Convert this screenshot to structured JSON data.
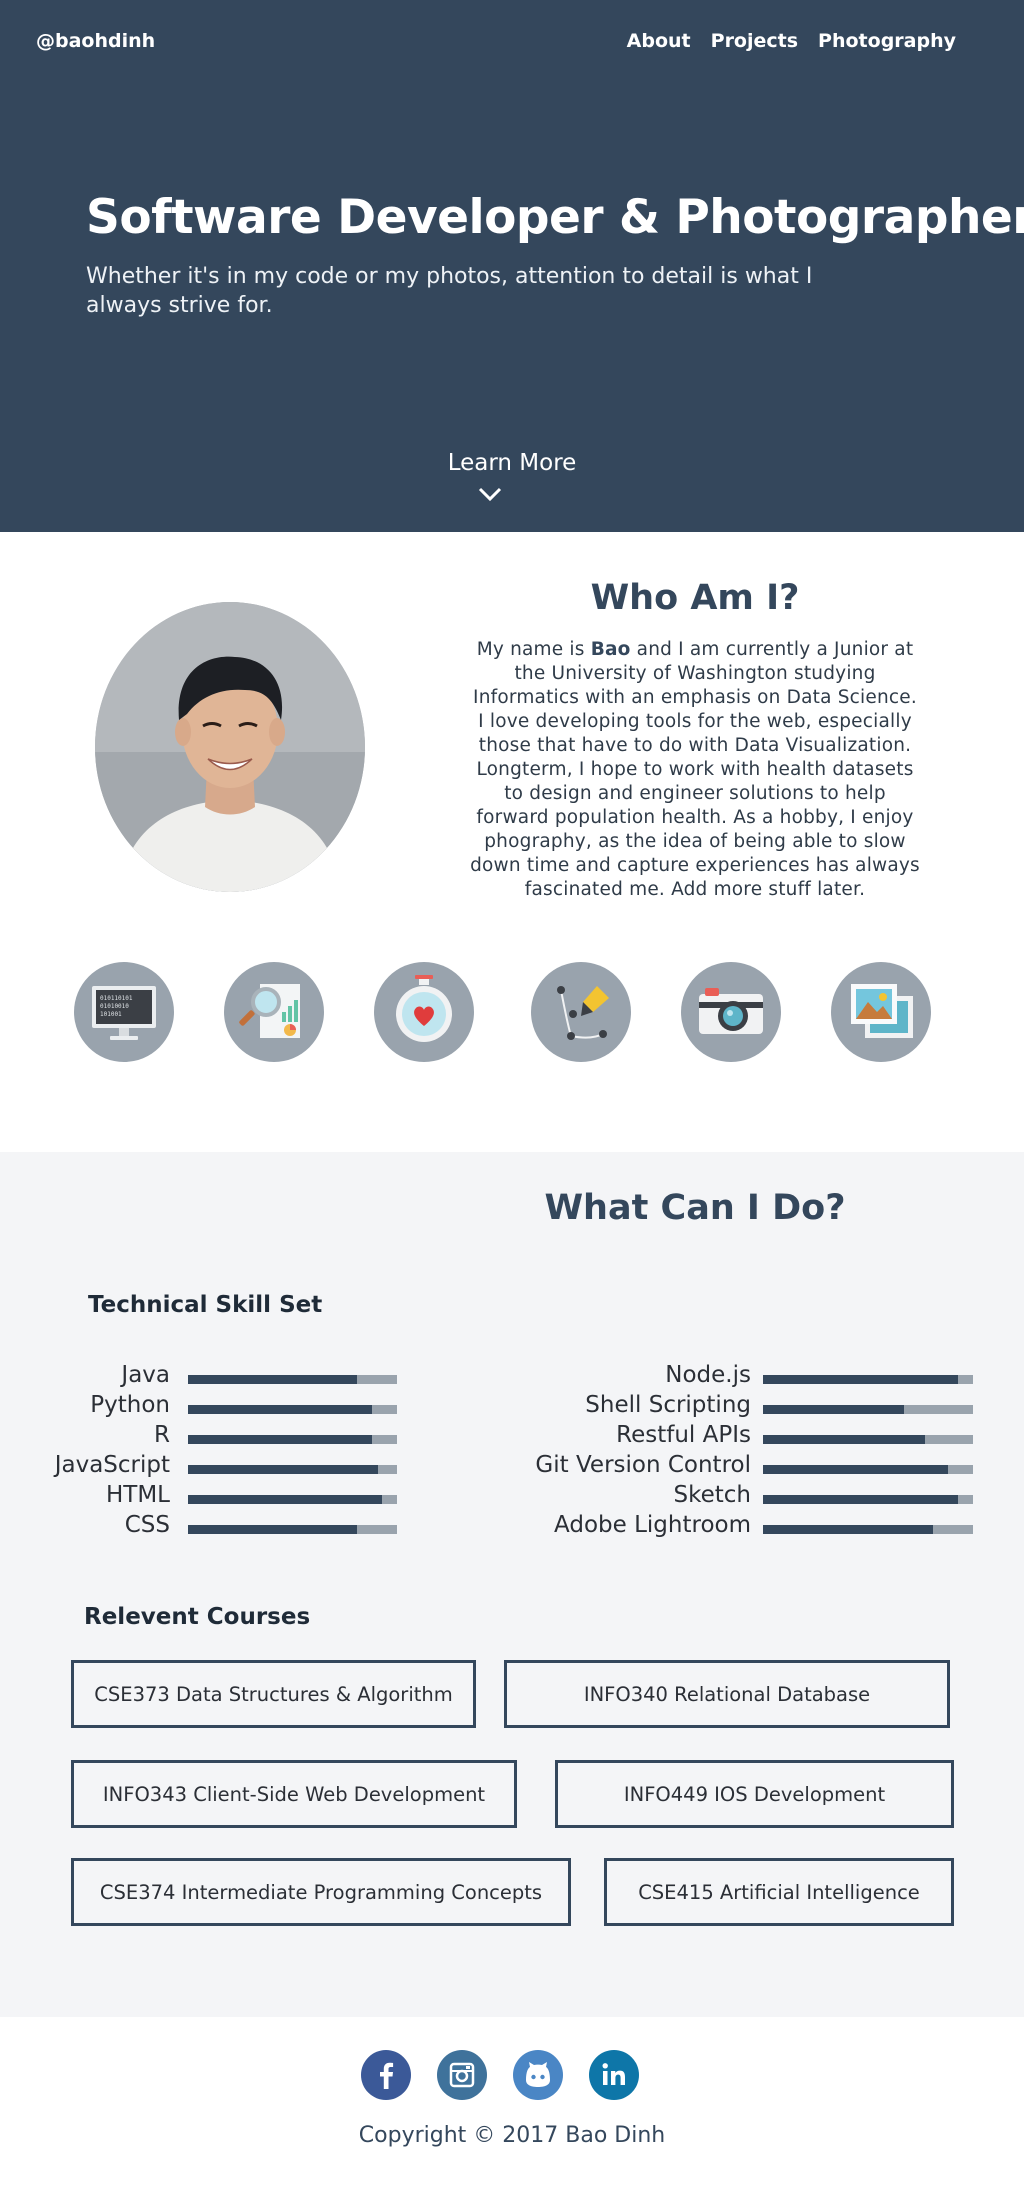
{
  "header": {
    "brand": "@baohdinh",
    "nav": [
      "About",
      "Projects",
      "Photography"
    ]
  },
  "hero": {
    "title": "Software Developer & Photographer",
    "subtitle": "Whether it's in my code or my photos, attention to detail is what I always strive for.",
    "learn_more": "Learn More"
  },
  "about": {
    "title": "Who Am I?",
    "text_before": "My name is ",
    "name": "Bao",
    "text_after": " and I am currently a Junior at the University of Washington studying Informatics with an emphasis on Data Science. I love developing tools for the web, especially those that have to do with Data Visualization. Longterm, I hope to work with health datasets to design and engineer solutions to help forward population health. As a hobby, I enjoy phography, as the idea of being able to slow down time and capture experiences has always fascinated me. Add more stuff later.",
    "icons": [
      "monitor-code-icon",
      "magnifier-report-icon",
      "stopwatch-heart-icon",
      "pen-tool-icon",
      "camera-icon",
      "photos-icon"
    ]
  },
  "skills": {
    "title": "What Can I Do?",
    "technical_heading": "Technical Skill Set",
    "left": [
      {
        "name": "Java",
        "level": 0.81
      },
      {
        "name": "Python",
        "level": 0.88
      },
      {
        "name": "R",
        "level": 0.88
      },
      {
        "name": "JavaScript",
        "level": 0.91
      },
      {
        "name": "HTML",
        "level": 0.93
      },
      {
        "name": "CSS",
        "level": 0.81
      }
    ],
    "right": [
      {
        "name": "Node.js",
        "level": 0.93
      },
      {
        "name": "Shell Scripting",
        "level": 0.67
      },
      {
        "name": "Restful APIs",
        "level": 0.77
      },
      {
        "name": "Git Version Control",
        "level": 0.88
      },
      {
        "name": "Sketch",
        "level": 0.93
      },
      {
        "name": "Adobe Lightroom",
        "level": 0.81
      }
    ],
    "courses_heading": "Relevent Courses",
    "courses": [
      "CSE373 Data Structures & Algorithm",
      "INFO340 Relational Database",
      "INFO343 Client-Side Web Development",
      "INFO449 IOS Development",
      "CSE374 Intermediate Programming Concepts",
      "CSE415 Artificial Intelligence"
    ]
  },
  "footer": {
    "social": [
      {
        "name": "facebook-icon",
        "color": "#3b5998"
      },
      {
        "name": "instagram-icon",
        "color": "#3f729b"
      },
      {
        "name": "github-icon",
        "color": "#4a86c5"
      },
      {
        "name": "linkedin-icon",
        "color": "#0e76a8"
      }
    ],
    "copyright": "Copyright © 2017 Bao Dinh"
  },
  "colors": {
    "primary": "#34475c",
    "bar_track": "#99a3ad",
    "section_bg": "#f4f5f7"
  }
}
